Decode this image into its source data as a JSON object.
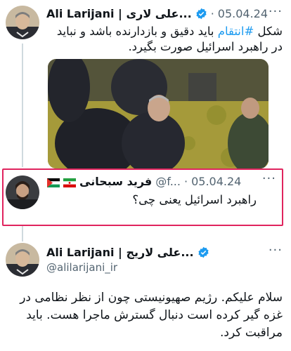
{
  "tweet1": {
    "display_name": "Ali Larijani | علی لاری...",
    "date": "05.04.24",
    "text_pre": "شکل ",
    "hashtag": "#انتقام",
    "text_post": " باید دقیق و بازدارنده باشد و نباید در راهبرد اسرائیل صورت بگیرد.",
    "more_icon": "more-dots-icon"
  },
  "quote": {
    "display_name": "فرید سبحانی",
    "handle": "@f...",
    "date": "05.04.24",
    "text": "راهبرد اسرائیل یعنی چی؟",
    "flag1": "iran-flag-icon",
    "flag2": "palestine-flag-icon"
  },
  "tweet2": {
    "display_name": "Ali Larijani | علی لاریج...",
    "handle": "@alilarijani_ir",
    "text": "سلام علیکم. رژیم صهیونیستی چون از نظر نظامی در غزه گیر کرده است دنبال گسترش ماجرا هست. باید مراقبت کرد."
  },
  "colors": {
    "accent": "#1d9bf0",
    "highlight": "#e0245e",
    "muted": "#536471"
  }
}
